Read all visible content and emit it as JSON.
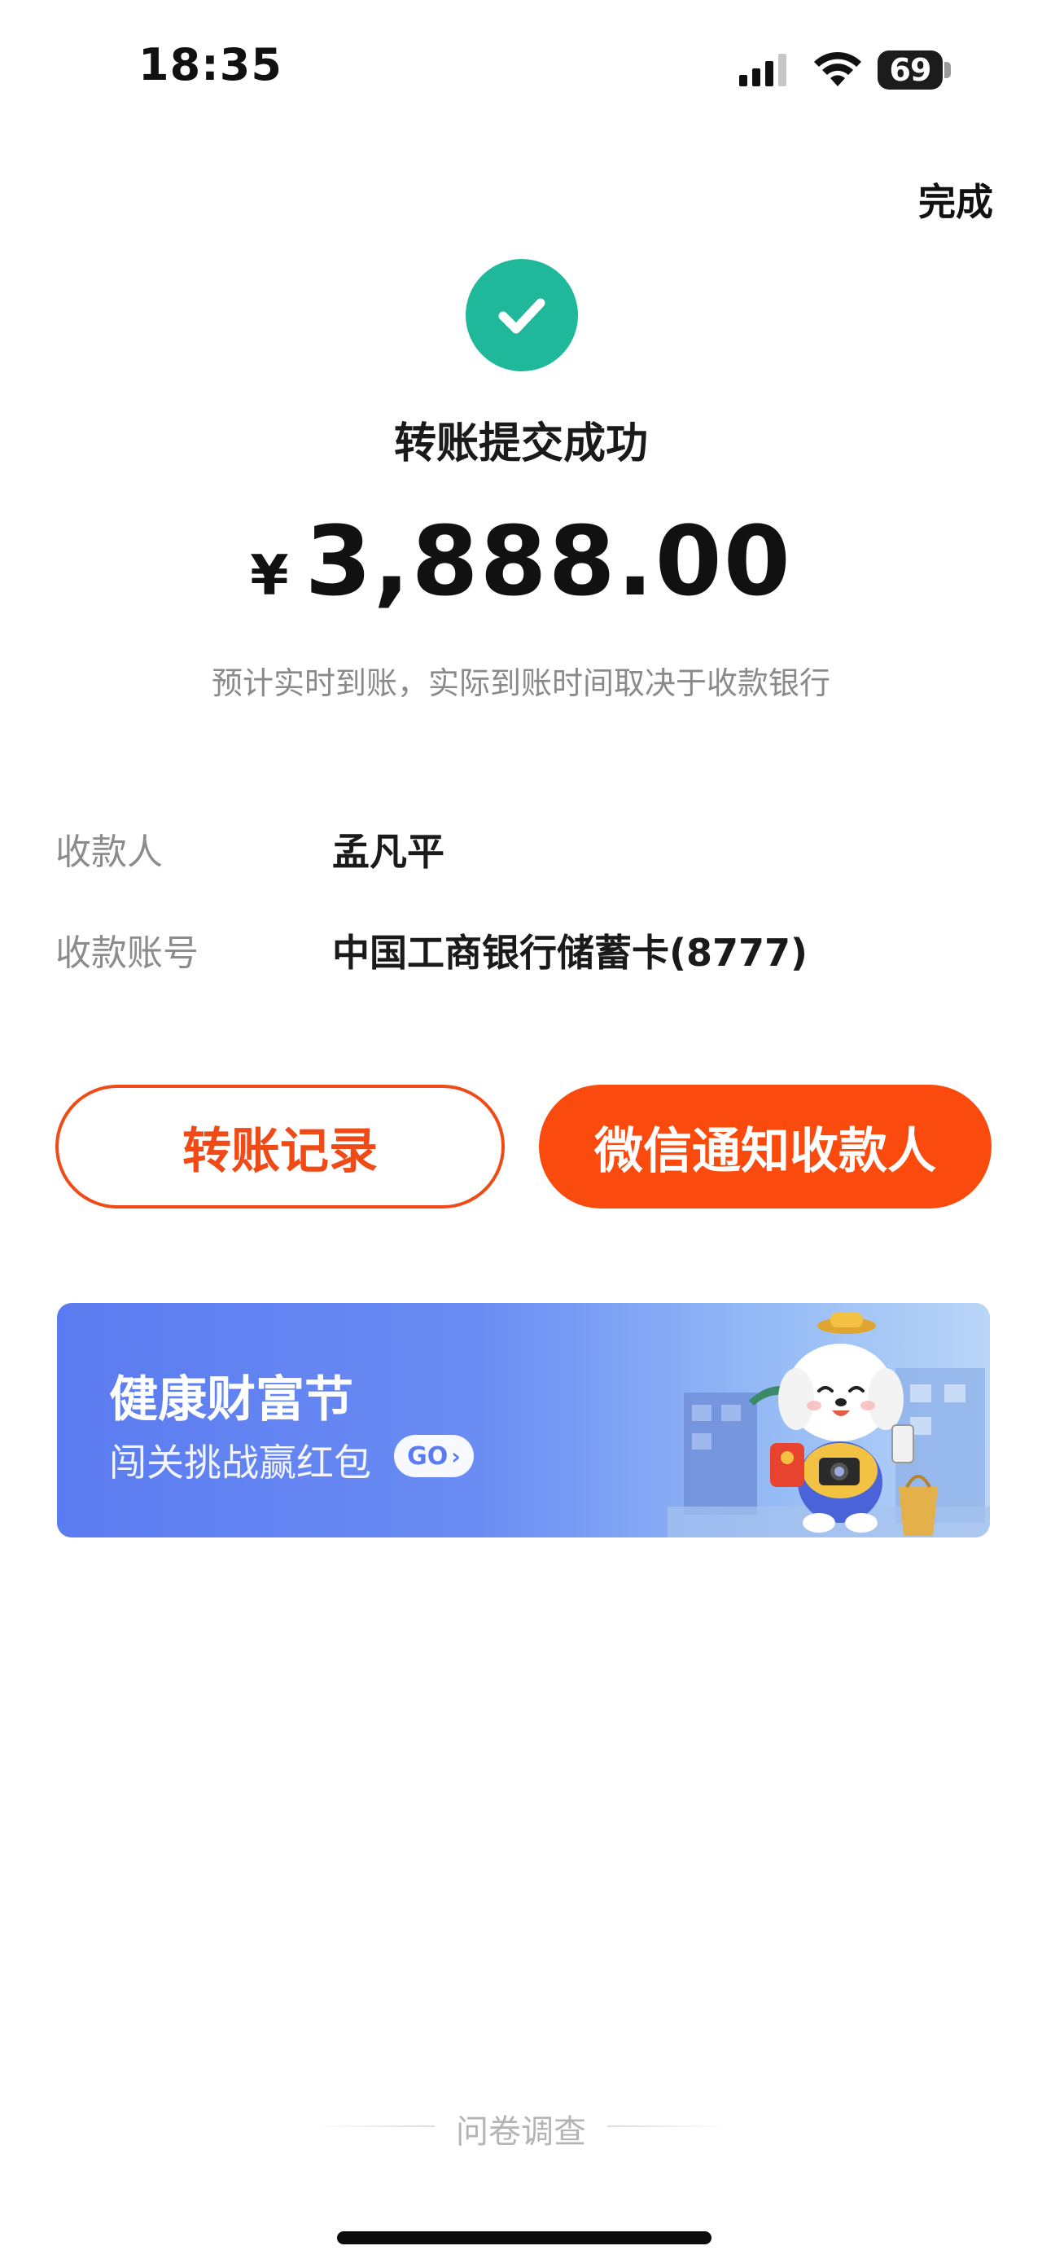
{
  "status_bar": {
    "time": "18:35",
    "battery_level": "69",
    "icons": [
      "signal-icon",
      "wifi-icon",
      "battery-icon"
    ]
  },
  "header": {
    "done_label": "完成"
  },
  "result": {
    "icon": "check-icon",
    "title": "转账提交成功",
    "currency": "¥",
    "amount": "3,888.00",
    "hint": "预计实时到账，实际到账时间取决于收款银行"
  },
  "details": [
    {
      "label": "收款人",
      "value": "孟凡平"
    },
    {
      "label": "收款账号",
      "value": "中国工商银行储蓄卡(8777)"
    }
  ],
  "actions": {
    "records_label": "转账记录",
    "notify_label": "微信通知收款人"
  },
  "banner": {
    "title": "健康财富节",
    "subtitle": "闯关挑战赢红包",
    "go_label": "GO",
    "illustration": "mascot-illustration"
  },
  "footer": {
    "survey_label": "问卷调查"
  },
  "colors": {
    "accent": "#fa4a0e",
    "success": "#1fb89a",
    "banner_start": "#5b7bf0",
    "banner_end": "#b9d6f7"
  }
}
